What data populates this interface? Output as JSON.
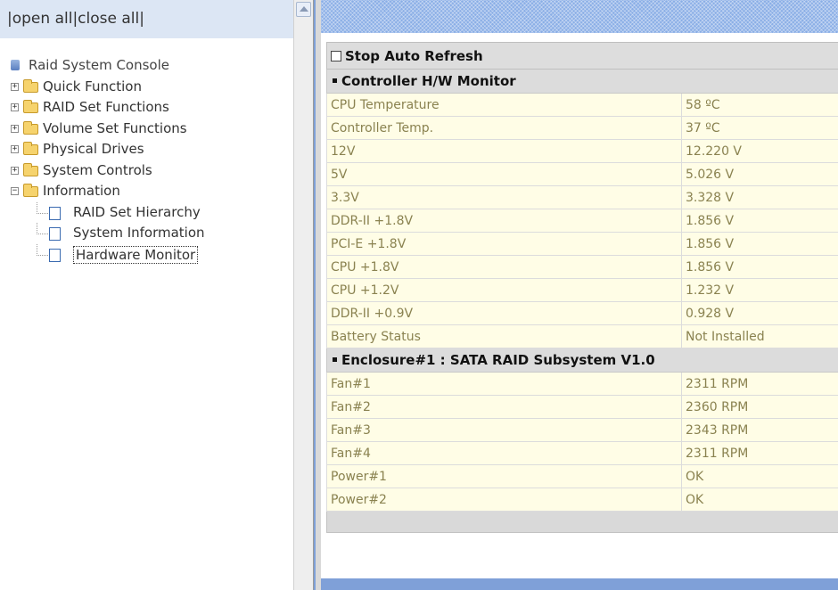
{
  "tree_frame": {
    "open_all": "open all",
    "close_all": "close all",
    "separator": "|",
    "root": "Raid System Console",
    "folders": [
      {
        "label": "Quick Function",
        "expanded": false
      },
      {
        "label": "RAID Set Functions",
        "expanded": false
      },
      {
        "label": "Volume Set Functions",
        "expanded": false
      },
      {
        "label": "Physical Drives",
        "expanded": false
      },
      {
        "label": "System Controls",
        "expanded": false
      },
      {
        "label": "Information",
        "expanded": true
      }
    ],
    "info_items": [
      "RAID Set Hierarchy",
      "System Information",
      "Hardware Monitor"
    ],
    "selected_item": "Hardware Monitor",
    "expander_plus": "+",
    "expander_minus": "−"
  },
  "monitor": {
    "auto_refresh_label": "Stop Auto Refresh",
    "controller_section": "Controller H/W Monitor",
    "controller_rows": [
      {
        "label": "CPU Temperature",
        "value": "58 ºC"
      },
      {
        "label": "Controller Temp.",
        "value": "37 ºC"
      },
      {
        "label": "12V",
        "value": "12.220 V"
      },
      {
        "label": "5V",
        "value": "5.026 V"
      },
      {
        "label": "3.3V",
        "value": "3.328 V"
      },
      {
        "label": "DDR-II +1.8V",
        "value": "1.856 V"
      },
      {
        "label": "PCI-E +1.8V",
        "value": "1.856 V"
      },
      {
        "label": "CPU +1.8V",
        "value": "1.856 V"
      },
      {
        "label": "CPU +1.2V",
        "value": "1.232 V"
      },
      {
        "label": "DDR-II +0.9V",
        "value": "0.928 V"
      },
      {
        "label": "Battery Status",
        "value": "Not Installed"
      }
    ],
    "enclosure_section": "Enclosure#1 : SATA RAID Subsystem V1.0",
    "enclosure_rows": [
      {
        "label": "Fan#1",
        "value": "2311 RPM"
      },
      {
        "label": "Fan#2",
        "value": "2360 RPM"
      },
      {
        "label": "Fan#3",
        "value": "2343 RPM"
      },
      {
        "label": "Fan#4",
        "value": "2311 RPM"
      },
      {
        "label": "Power#1",
        "value": "OK"
      },
      {
        "label": "Power#2",
        "value": "OK"
      }
    ]
  },
  "colors": {
    "frame_blue": "#7fa0d8",
    "row_bg": "#fffde6",
    "row_text": "#8a8250",
    "section_bg": "#dcdcdc",
    "tree_header_bg": "#dce6f4"
  }
}
